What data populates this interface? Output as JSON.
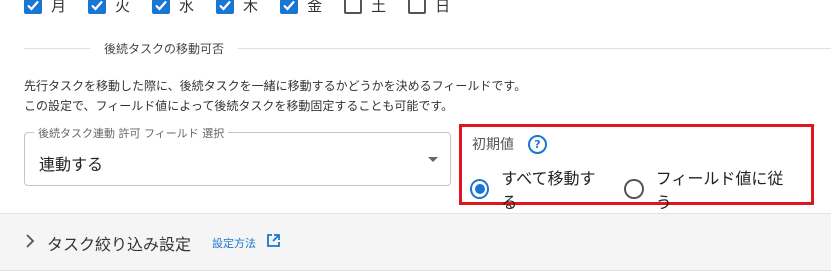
{
  "weekdays": [
    {
      "label": "月",
      "checked": true
    },
    {
      "label": "火",
      "checked": true
    },
    {
      "label": "水",
      "checked": true
    },
    {
      "label": "木",
      "checked": true
    },
    {
      "label": "金",
      "checked": true
    },
    {
      "label": "土",
      "checked": false
    },
    {
      "label": "日",
      "checked": false
    }
  ],
  "section": {
    "title": "後続タスクの移動可否",
    "description_line1": "先行タスクを移動した際に、後続タスクを一緒に移動するかどうかを決めるフィールドです。",
    "description_line2": "この設定で、フィールド値によって後続タスクを移動固定することも可能です。"
  },
  "select": {
    "label": "後続タスク連動 許可 フィールド 選択",
    "value": "連動する"
  },
  "default_value": {
    "label": "初期値",
    "help_icon": "help-circle-icon",
    "options": [
      {
        "label": "すべて移動する",
        "selected": true
      },
      {
        "label": "フィールド値に従う",
        "selected": false
      }
    ]
  },
  "accordion": {
    "title": "タスク絞り込み設定",
    "link_label": "設定方法",
    "link_icon": "external-link-icon"
  },
  "colors": {
    "accent": "#1976d2",
    "highlight": "#e0161f"
  }
}
